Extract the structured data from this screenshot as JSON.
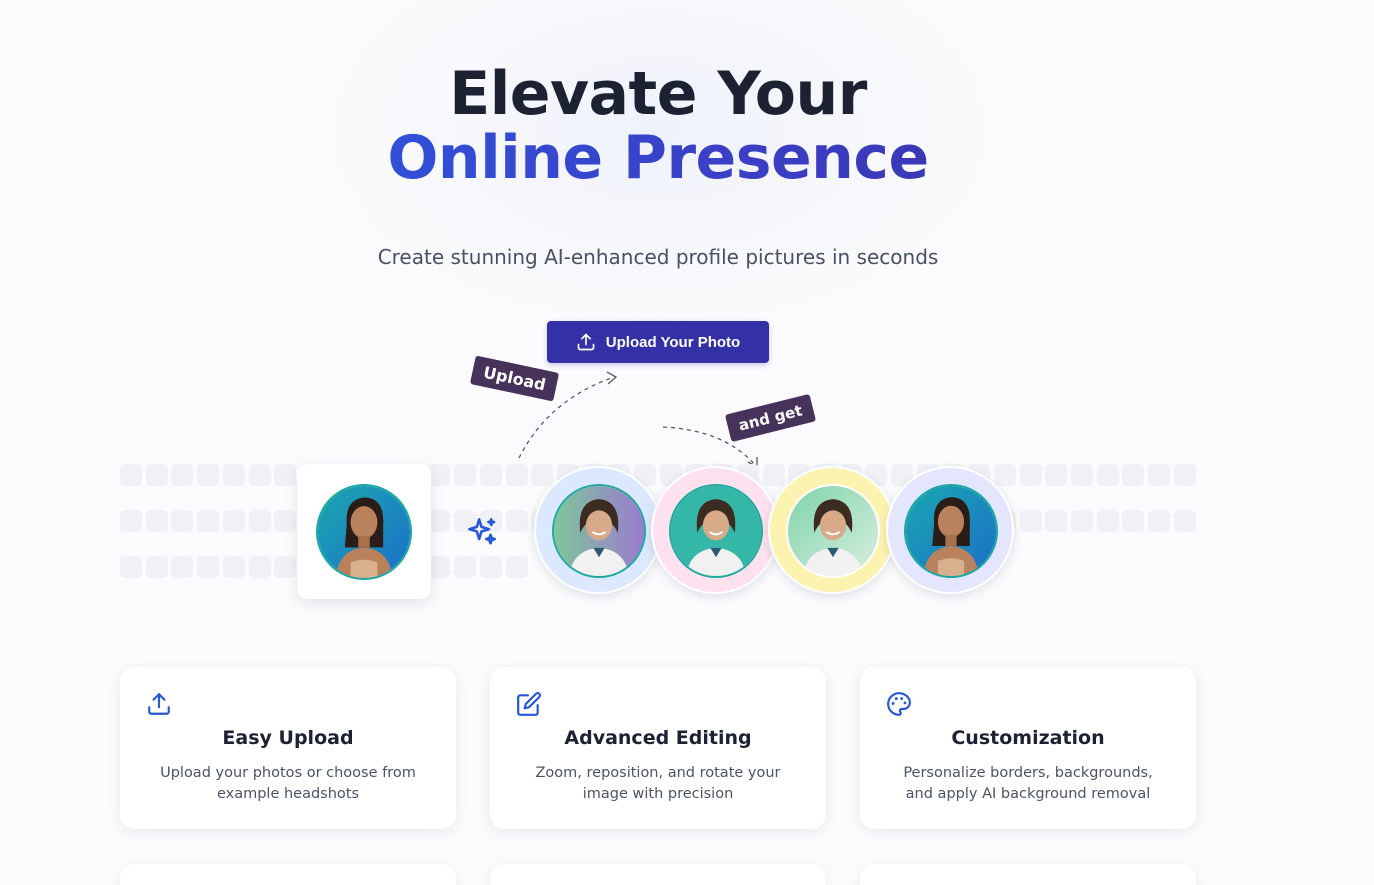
{
  "hero": {
    "title_line1": "Elevate Your",
    "title_line2": "Online Presence",
    "subtitle": "Create stunning AI-enhanced profile pictures in seconds"
  },
  "cta": {
    "upload_label": "Upload Your Photo",
    "icon": "upload-icon"
  },
  "demo": {
    "tag_upload": "Upload",
    "tag_and_get": "and get",
    "sparkle_icon": "sparkles-icon",
    "result_ring_colors": [
      "#dbe8fd",
      "#fde1ee",
      "#fdf3b0",
      "#e3e6fd"
    ]
  },
  "features": [
    {
      "icon": "upload-icon",
      "title": "Easy Upload",
      "description": "Upload your photos or choose from example headshots"
    },
    {
      "icon": "edit-icon",
      "title": "Advanced Editing",
      "description": "Zoom, reposition, and rotate your image with precision"
    },
    {
      "icon": "palette-icon",
      "title": "Customization",
      "description": "Personalize borders, backgrounds, and apply AI background removal"
    }
  ],
  "colors": {
    "brand": "#3430a6",
    "gradient_start": "#2563eb",
    "tag_bg": "#47325a",
    "icon_blue": "#2557d6"
  }
}
